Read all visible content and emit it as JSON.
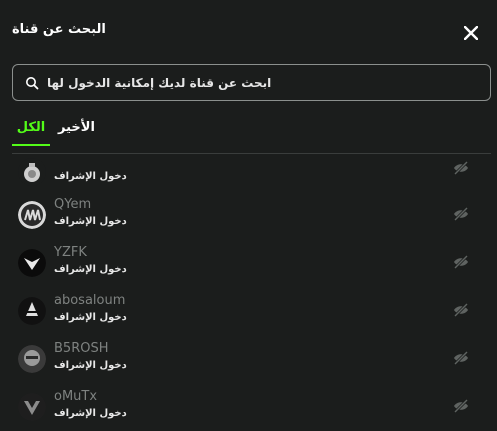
{
  "header": {
    "title": "البحث عن قناة"
  },
  "search": {
    "placeholder": "ابحث عن قناة لديك إمكانية الدخول لها"
  },
  "tabs": [
    {
      "label": "الكل",
      "active": true
    },
    {
      "label": "الأخير",
      "active": false
    }
  ],
  "channels": [
    {
      "name": "",
      "access": "دخول الإشراف"
    },
    {
      "name": "QYem",
      "access": "دخول الإشراف"
    },
    {
      "name": "YZFK",
      "access": "دخول الإشراف"
    },
    {
      "name": "abosaloum",
      "access": "دخول الإشراف"
    },
    {
      "name": "B5ROSH",
      "access": "دخول الإشراف"
    },
    {
      "name": "oMuTx",
      "access": "دخول الإشراف"
    }
  ],
  "colors": {
    "accent": "#53fc18",
    "background": "#1b1d1c"
  },
  "icons": {
    "close": "close-icon",
    "search": "search-icon",
    "hidden": "eye-off-icon"
  }
}
